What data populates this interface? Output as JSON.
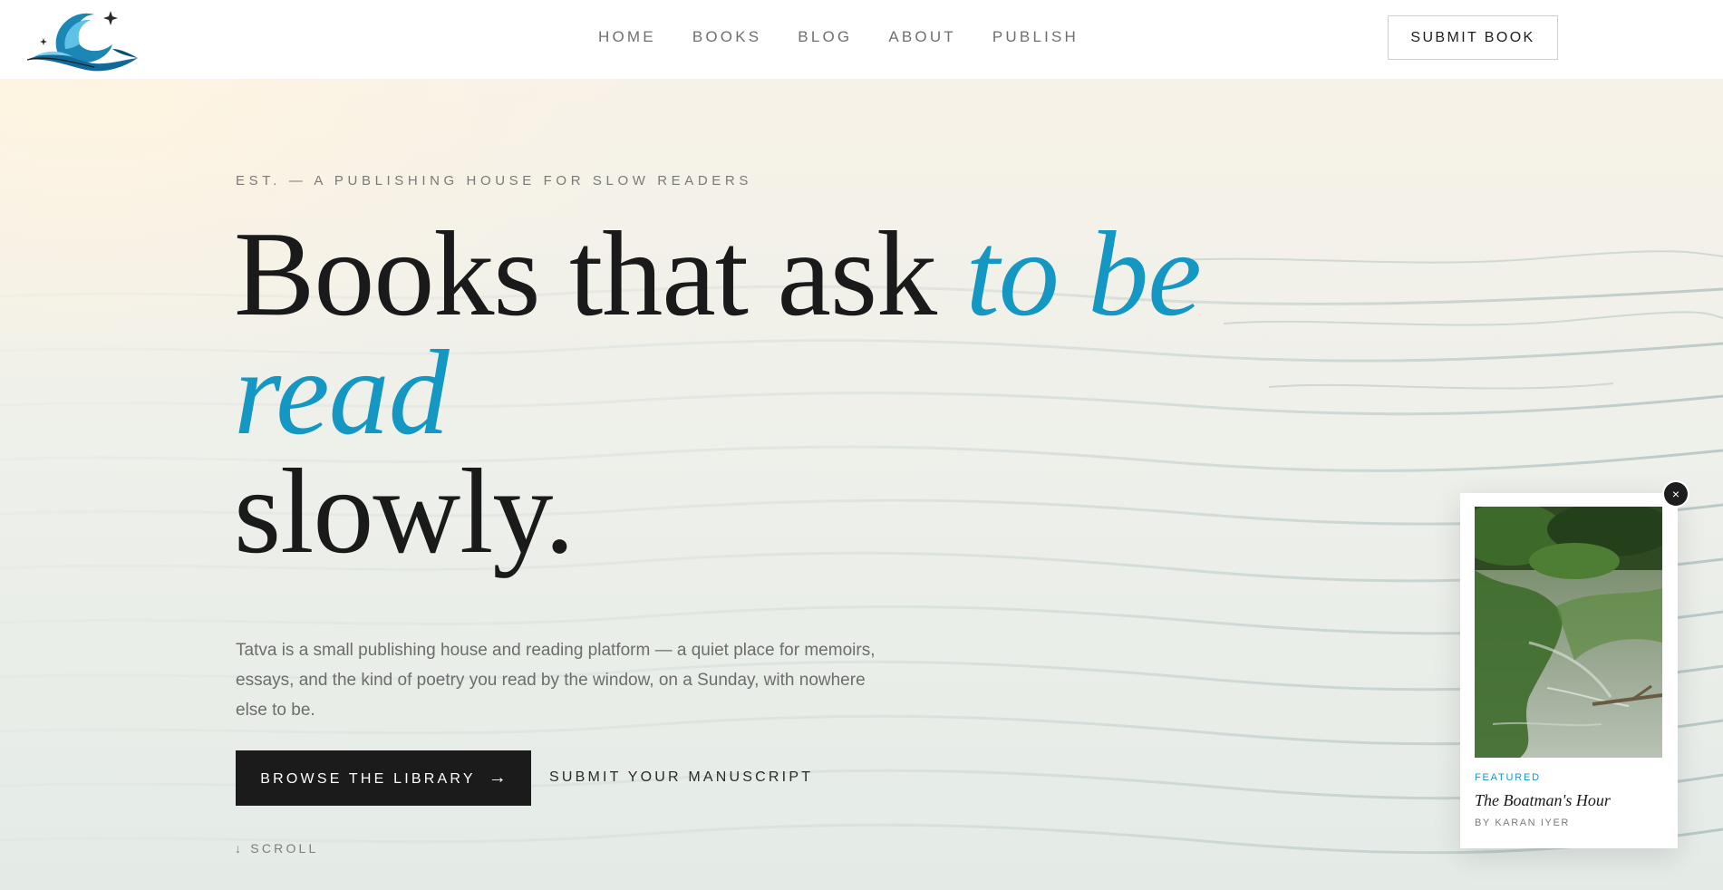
{
  "brand": {
    "logo_icon": "wave-logo-icon",
    "colors": {
      "accent": "#1497c2",
      "dark": "#1b1b1b"
    }
  },
  "nav": {
    "items": [
      {
        "label": "HOME"
      },
      {
        "label": "BOOKS"
      },
      {
        "label": "BLOG"
      },
      {
        "label": "ABOUT"
      },
      {
        "label": "PUBLISH"
      }
    ],
    "cta": "SUBMIT BOOK"
  },
  "hero": {
    "eyebrow": "EST. — A PUBLISHING HOUSE FOR SLOW READERS",
    "headline_start": "Books that ask ",
    "headline_accent": "to be read",
    "headline_end": "slowly.",
    "lede": "Tatva is a small publishing house and reading platform — a quiet place for memoirs, essays, and the kind of poetry you read by the window, on a Sunday, with nowhere else to be.",
    "primary_button": "BROWSE THE LIBRARY",
    "primary_button_icon": "→",
    "secondary_button": "SUBMIT YOUR MANUSCRIPT",
    "scroll_label": "↓ SCROLL"
  },
  "featured": {
    "label": "FEATURED",
    "title": "The Boatman's Hour",
    "author": "BY KARAN IYER",
    "close_icon": "×"
  }
}
